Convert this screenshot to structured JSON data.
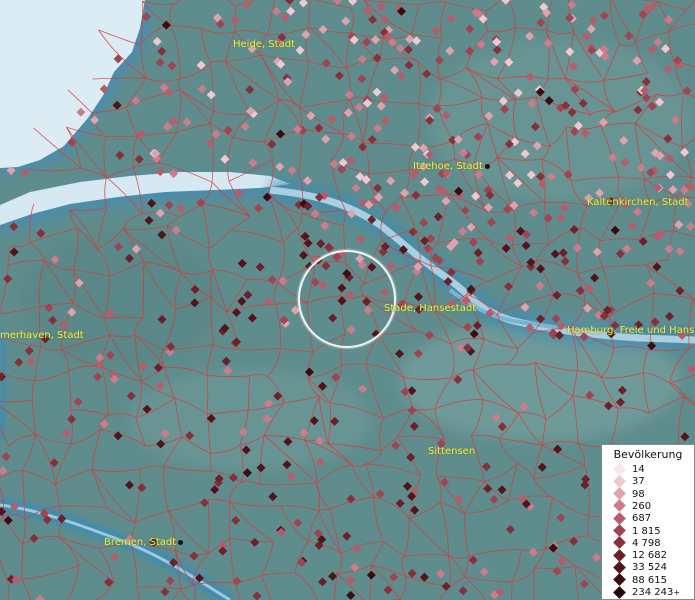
{
  "places": [
    {
      "name": "Heide, Stadt",
      "dot": false
    },
    {
      "name": "Itzehoe, Stadt",
      "dot": true
    },
    {
      "name": "Kaltenkirchen, Stadt",
      "dot": true
    },
    {
      "name": "Stade, Hansestadt",
      "dot": false
    },
    {
      "name": "merhaven, Stadt",
      "dot": false
    },
    {
      "name": "Hamburg, Freie und Hans",
      "dot": true
    },
    {
      "name": "Sittensen",
      "dot": false
    },
    {
      "name": "Bremen, Stadt",
      "dot": true
    }
  ],
  "legend": {
    "title": "Bevölkerung",
    "entries": [
      {
        "label": "14",
        "color": "#f7e7ea"
      },
      {
        "label": "37",
        "color": "#efc9d0"
      },
      {
        "label": "98",
        "color": "#dfa3ae"
      },
      {
        "label": "260",
        "color": "#cc7d8b"
      },
      {
        "label": "687",
        "color": "#b55d6b"
      },
      {
        "label": "1 815",
        "color": "#9e4452"
      },
      {
        "label": "4 798",
        "color": "#86303c"
      },
      {
        "label": "12 682",
        "color": "#6c2029"
      },
      {
        "label": "33 524",
        "color": "#52141b"
      },
      {
        "label": "88 615",
        "color": "#3a0c11"
      },
      {
        "label": "234 243",
        "color": "#230508"
      }
    ],
    "plus": "+"
  },
  "colors": {
    "land": "#5f8d8d",
    "water": "#dcecf4",
    "river": "#3c8cb4",
    "boundary": "#d83a3a",
    "label": "#f2e94a"
  }
}
